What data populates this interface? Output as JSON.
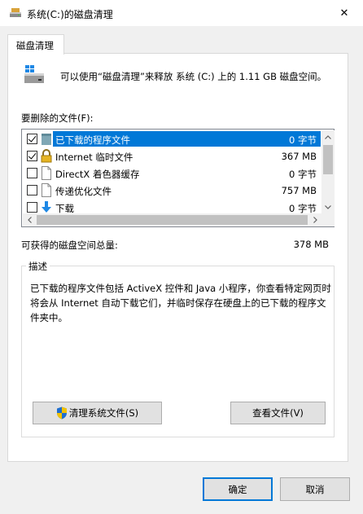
{
  "window": {
    "title": "系统(C:)的磁盘清理",
    "close_glyph": "✕"
  },
  "tabs": [
    {
      "label": "磁盘清理"
    }
  ],
  "intro_text": "可以使用“磁盘清理”来释放 系统 (C:) 上的 1.11 GB 磁盘空间。",
  "files_label": "要删除的文件(F):",
  "files": [
    {
      "name": "已下载的程序文件",
      "size": "0 字节",
      "checked": true,
      "selected": true,
      "icon": "folder-icon"
    },
    {
      "name": "Internet 临时文件",
      "size": "367 MB",
      "checked": true,
      "selected": false,
      "icon": "lock-icon"
    },
    {
      "name": "DirectX 着色器缓存",
      "size": "0 字节",
      "checked": false,
      "selected": false,
      "icon": "document-icon"
    },
    {
      "name": "传递优化文件",
      "size": "757 MB",
      "checked": false,
      "selected": false,
      "icon": "document-icon"
    },
    {
      "name": "下载",
      "size": "0 字节",
      "checked": false,
      "selected": false,
      "icon": "download-arrow-icon"
    }
  ],
  "space_label": "可获得的磁盘空间总量:",
  "space_value": "378 MB",
  "description": {
    "title": "描述",
    "text": "已下载的程序文件包括 ActiveX 控件和 Java 小程序，你查看特定网页时将会从 Internet 自动下载它们，并临时保存在硬盘上的已下载的程序文件夹中。"
  },
  "buttons": {
    "clean_system": "清理系统文件(S)",
    "view_files": "查看文件(V)",
    "ok": "确定",
    "cancel": "取消"
  },
  "colors": {
    "selection": "#0078d7",
    "shield_blue": "#1f6fd0",
    "shield_yellow": "#f2c200"
  }
}
